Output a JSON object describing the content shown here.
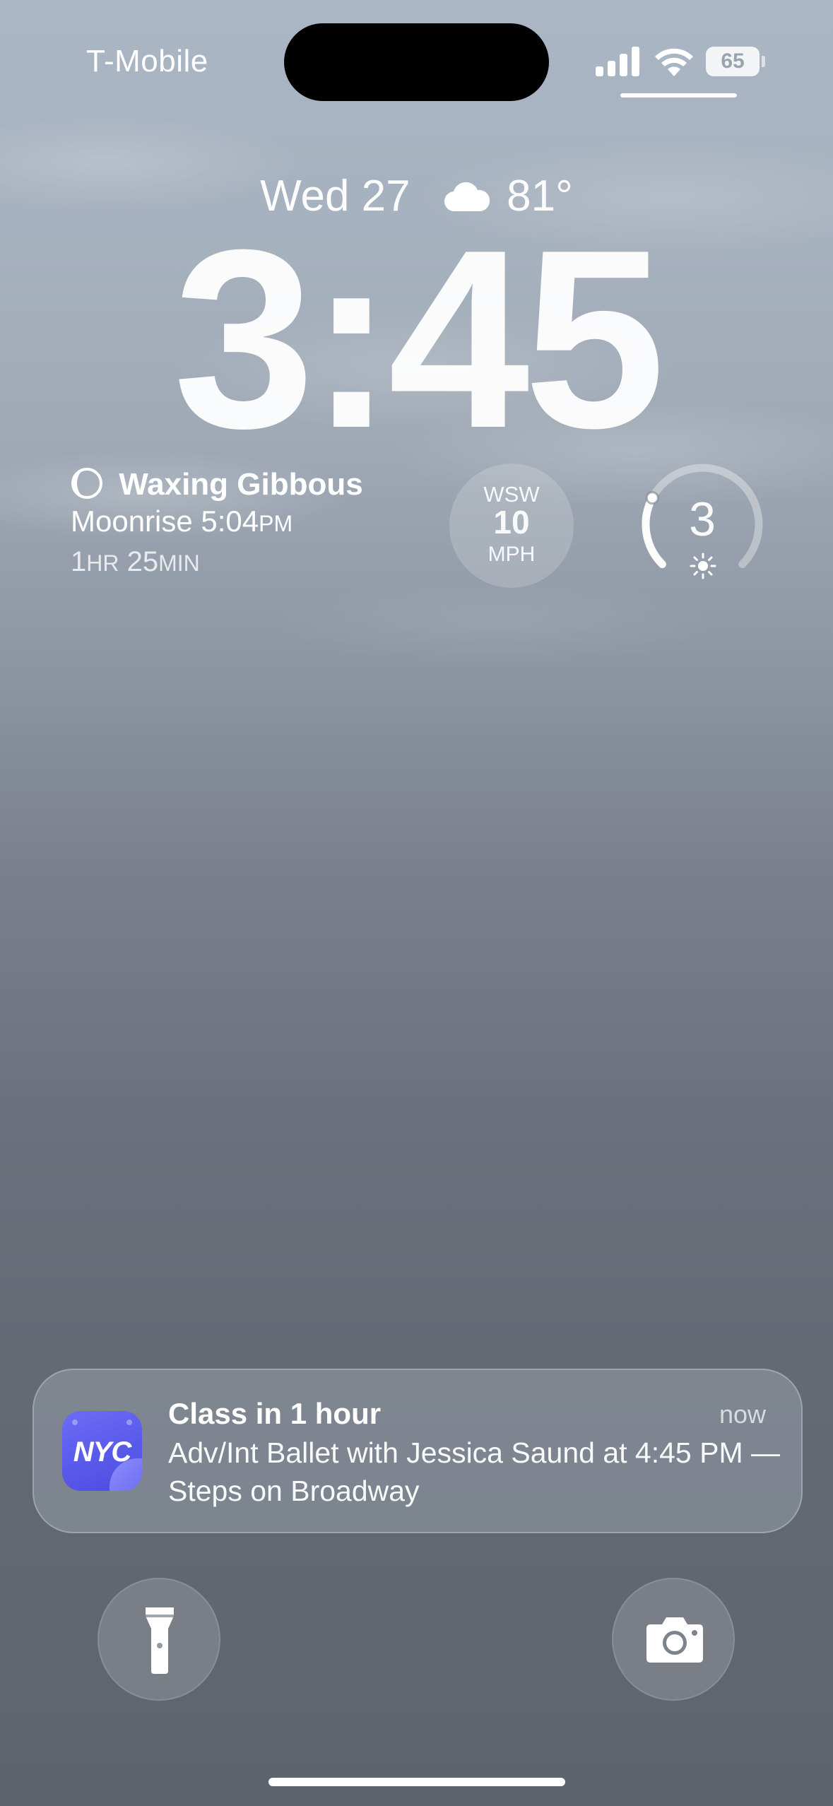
{
  "status_bar": {
    "carrier": "T-Mobile",
    "battery_level": "65",
    "icons": [
      "cellular-signal-icon",
      "wifi-icon",
      "battery-icon"
    ]
  },
  "lock_screen": {
    "date": "Wed 27",
    "weather_icon": "cloud-icon",
    "temperature": "81°",
    "time": "3:45"
  },
  "widgets": {
    "moon": {
      "icon": "moon-phase-icon",
      "phase": "Waxing Gibbous",
      "moonrise_label": "Moonrise 5:04",
      "moonrise_suffix": "PM",
      "countdown_h": "1",
      "countdown_h_unit": "HR",
      "countdown_m": "25",
      "countdown_m_unit": "MIN"
    },
    "wind": {
      "direction": "WSW",
      "speed": "10",
      "unit": "MPH"
    },
    "uv_index": {
      "value": "3",
      "icon": "sun-icon",
      "level_fraction": 0.27
    }
  },
  "notification": {
    "app_icon": "nyc-app-icon",
    "app_icon_text": "NYC",
    "title": "Class in 1 hour",
    "time": "now",
    "body": "Adv/Int Ballet with Jessica Saund at 4:45 PM — Steps on Broadway"
  },
  "quick_actions": {
    "left": "flashlight-icon",
    "right": "camera-icon"
  },
  "colors": {
    "app_icon_accent": "#5b5bea",
    "text": "#ffffff"
  }
}
